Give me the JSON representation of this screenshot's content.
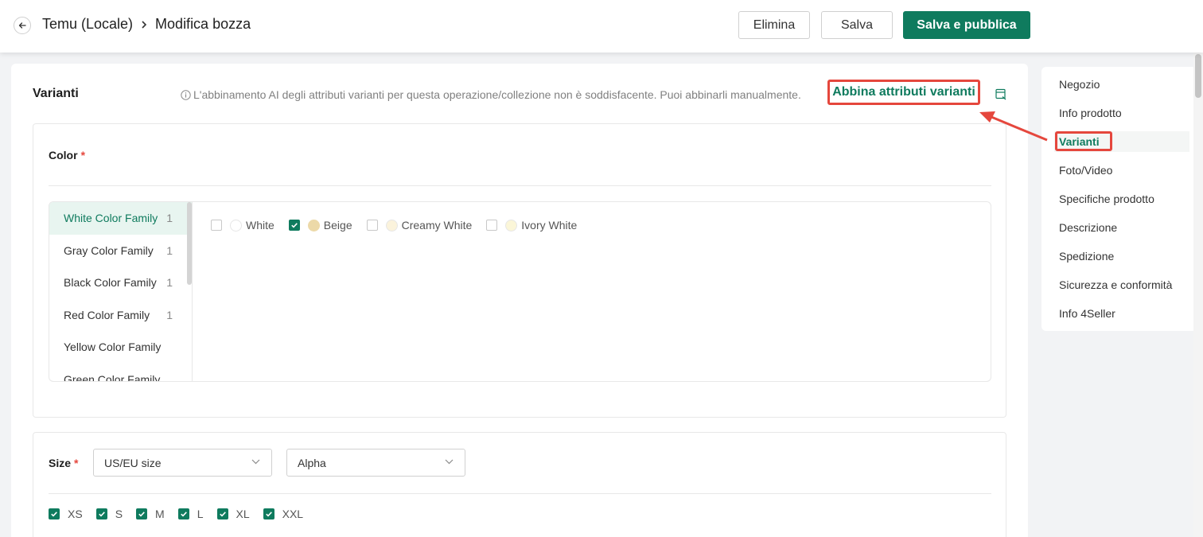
{
  "header": {
    "breadcrumb_root": "Temu (Locale)",
    "breadcrumb_current": "Modifica bozza",
    "delete_label": "Elimina",
    "save_label": "Salva",
    "publish_label": "Salva e pubblica"
  },
  "variants": {
    "title": "Varianti",
    "ai_note": "L'abbinamento AI degli attributi varianti per questa operazione/collezione non è soddisfacente. Puoi abbinarli manualmente.",
    "match_link": "Abbina attributi varianti"
  },
  "color": {
    "label": "Color",
    "required_mark": "*",
    "families": [
      {
        "name": "White Color Family",
        "count": "1",
        "active": true
      },
      {
        "name": "Gray Color Family",
        "count": "1"
      },
      {
        "name": "Black Color Family",
        "count": "1"
      },
      {
        "name": "Red Color Family",
        "count": "1"
      },
      {
        "name": "Yellow Color Family",
        "count": ""
      },
      {
        "name": "Green Color Family",
        "count": ""
      }
    ],
    "options": [
      {
        "label": "White",
        "checked": false,
        "swatch": "#ffffff"
      },
      {
        "label": "Beige",
        "checked": true,
        "swatch": "#ecd9a8"
      },
      {
        "label": "Creamy White",
        "checked": false,
        "swatch": "#fbf3dc"
      },
      {
        "label": "Ivory White",
        "checked": false,
        "swatch": "#fbf6d8"
      }
    ]
  },
  "size": {
    "label": "Size",
    "required_mark": "*",
    "system_select": "US/EU size",
    "type_select": "Alpha",
    "options": [
      {
        "label": "XS",
        "checked": true
      },
      {
        "label": "S",
        "checked": true
      },
      {
        "label": "M",
        "checked": true
      },
      {
        "label": "L",
        "checked": true
      },
      {
        "label": "XL",
        "checked": true
      },
      {
        "label": "XXL",
        "checked": true
      }
    ]
  },
  "nav": {
    "items": [
      {
        "label": "Negozio"
      },
      {
        "label": "Info prodotto"
      },
      {
        "label": "Varianti",
        "active": true
      },
      {
        "label": "Foto/Video"
      },
      {
        "label": "Specifiche prodotto"
      },
      {
        "label": "Descrizione"
      },
      {
        "label": "Spedizione"
      },
      {
        "label": "Sicurezza e conformità"
      },
      {
        "label": "Info 4Seller"
      }
    ]
  },
  "colors": {
    "brand": "#0f7b5e",
    "annotation": "#e5473d"
  }
}
